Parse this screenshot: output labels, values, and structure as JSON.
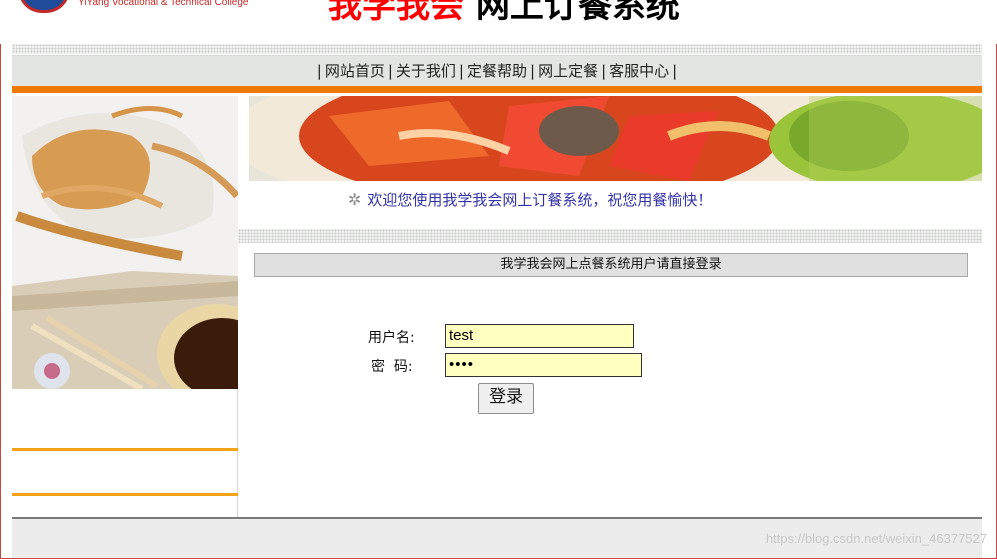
{
  "header": {
    "logo_caption": "YiYang Vocational & Technical College",
    "title_red": "我学我会",
    "title_black": " 网上订餐系统"
  },
  "nav": {
    "items": [
      "网站首页",
      "关于我们",
      "定餐帮助",
      "网上定餐",
      "客服中心"
    ]
  },
  "banner": {
    "welcome": "欢迎您使用我学我会网上订餐系统，祝您用餐愉快！"
  },
  "login": {
    "panel_title": "我学我会网上点餐系统用户请直接登录",
    "username_label": "用户名:",
    "username_value": "test",
    "password_label": "密  码:",
    "password_value": "••••",
    "submit_label": "登录"
  },
  "footer": {
    "watermark": "https://blog.csdn.net/weixin_46377527"
  },
  "colors": {
    "nav_orange": "#ef7a00",
    "title_red": "#ff0000",
    "input_bg": "#ffffc0",
    "welcome_text": "#3333aa"
  }
}
